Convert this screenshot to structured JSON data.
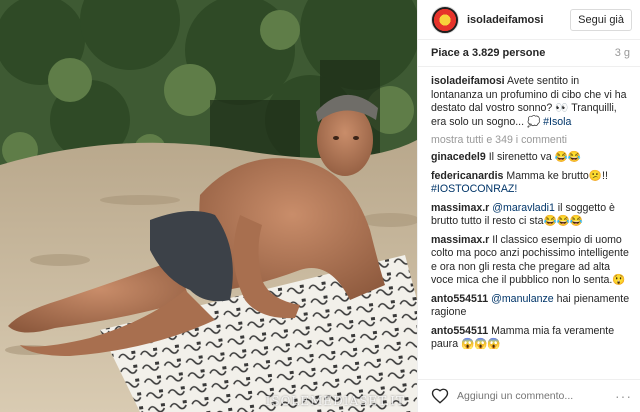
{
  "header": {
    "username": "isoladeifamosi",
    "follow_label": "Segui già"
  },
  "stats": {
    "likes": "Piace a 3.829 persone",
    "age": "3 g"
  },
  "caption": {
    "user": "isoladeifamosi",
    "text": "Avete sentito in lontananza un profumino di cibo che vi ha destato dal vostro sonno? 👀 Tranquilli, era solo un sogno... 💭",
    "hashtag": "#Isola"
  },
  "view_more": "mostra tutti e 349 i commenti",
  "comments": [
    {
      "user": "ginacedel9",
      "mention": "",
      "text": "Il sirenetto va 😂😂",
      "hashtag": ""
    },
    {
      "user": "federicanardis",
      "mention": "",
      "text": "Mamma ke brutto😕!!",
      "hashtag": "#IOSTOCONRAZ!"
    },
    {
      "user": "massimax.r",
      "mention": "@maravladi1",
      "text": "il soggetto è brutto tutto il resto ci sta😂😂😂",
      "hashtag": ""
    },
    {
      "user": "massimax.r",
      "mention": "",
      "text": "Il classico esempio di uomo colto ma poco anzi pochissimo intelligente e ora non gli resta che pregare ad alta voce mica che il pubblico non lo senta.😲",
      "hashtag": ""
    },
    {
      "user": "anto554511",
      "mention": "@manulanze",
      "text": "hai pienamente ragione",
      "hashtag": ""
    },
    {
      "user": "anto554511",
      "mention": "",
      "text": "Mamma mia fa veramente paura 😱😱😱",
      "hashtag": ""
    }
  ],
  "add_comment": {
    "placeholder": "Aggiungi un commento..."
  },
  "more_options": "···",
  "watermark": "ISOLEMEDIASET.IT",
  "icons": {
    "like": "heart-icon",
    "options": "more-options-icon"
  },
  "colors": {
    "link": "#003569",
    "muted": "#999999",
    "border": "#efefef"
  }
}
